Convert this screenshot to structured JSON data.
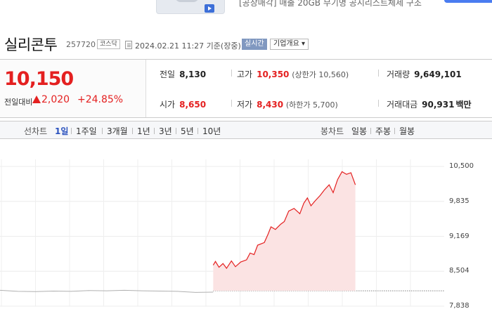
{
  "ad": {
    "text": "[공장매각] 매출 20GB 무기명 공시리스트체제 구조"
  },
  "header": {
    "stock_name": "실리콘투",
    "stock_code": "257720",
    "market": "코스닥",
    "timestamp": "2024.02.21 11:27 기준(장중)",
    "realtime_label": "실시간",
    "company_button": "기업개요 ▾"
  },
  "price": {
    "current": "10,150",
    "diff_label": "전일대비",
    "diff": "2,020",
    "rate": "+24.85%"
  },
  "stats": {
    "prev_label": "전일",
    "prev": "8,130",
    "high_label": "고가",
    "high": "10,350",
    "upper_limit": "(상한가 10,560)",
    "volume_label": "거래량",
    "volume": "9,649,101",
    "open_label": "시가",
    "open": "8,650",
    "low_label": "저가",
    "low": "8,430",
    "lower_limit": "(하한가 5,700)",
    "amount_label": "거래대금",
    "amount": "90,931",
    "amount_unit": "백만"
  },
  "tabs": {
    "line_label": "선차트",
    "line_periods": [
      "1일",
      "1주일",
      "3개월",
      "1년",
      "3년",
      "5년",
      "10년"
    ],
    "active_index": 0,
    "candle_label": "봉차트",
    "candle_periods": [
      "일봉",
      "주봉",
      "월봉"
    ]
  },
  "colors": {
    "up": "#e42020",
    "accent": "#2a52be"
  },
  "chart_data": {
    "type": "line",
    "y_ticks": [
      "10,500",
      "9,835",
      "9,169",
      "8,504",
      "7,838"
    ],
    "ylim": [
      7838,
      10500
    ],
    "xlim": [
      0,
      100
    ],
    "reference_value": 8130,
    "premarket": {
      "x": [
        0,
        4,
        8,
        12,
        16,
        20,
        24,
        28,
        32,
        36,
        40,
        44,
        48
      ],
      "y": [
        8140,
        8120,
        8115,
        8125,
        8120,
        8135,
        8130,
        8140,
        8130,
        8125,
        8120,
        8100,
        8105
      ]
    },
    "session": {
      "x": [
        48,
        48.5,
        49.3,
        50.2,
        51,
        52.1,
        53,
        54.2,
        55.5,
        56.3,
        57.2,
        58,
        59.5,
        60.3,
        61,
        62,
        63.2,
        64,
        65,
        66.2,
        67.5,
        68.4,
        69.2,
        70,
        71,
        72.1,
        73,
        74.1,
        75,
        76,
        77,
        78,
        79,
        80
      ],
      "y": [
        8620,
        8690,
        8580,
        8650,
        8560,
        8700,
        8590,
        8680,
        8720,
        8850,
        8820,
        9000,
        9050,
        9200,
        9350,
        9300,
        9400,
        9450,
        9650,
        9700,
        9600,
        9800,
        9900,
        9750,
        9850,
        9950,
        10050,
        10150,
        10000,
        10250,
        10400,
        10350,
        10380,
        10150
      ]
    }
  }
}
